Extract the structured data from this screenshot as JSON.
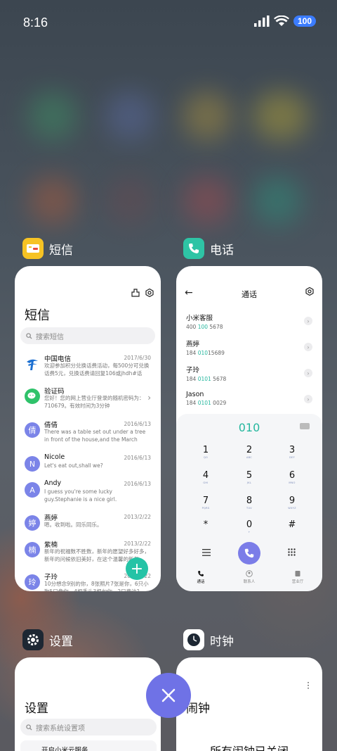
{
  "status_bar": {
    "time": "8:16",
    "battery": "100"
  },
  "apps": {
    "sms": {
      "label": "短信",
      "title": "短信",
      "search_placeholder": "搜索短信",
      "messages": [
        {
          "avatar": "",
          "name": "中国电信",
          "date": "2017/6/30",
          "preview": "欢迎参加积分兑换话费活动，每500分可兑换话费5元，兑换话费请回复106或jhdh#话费..."
        },
        {
          "avatar": "",
          "name": "验证码",
          "date": "",
          "preview": "您好！您的网上营业厅登录的随机密码为：710679。有效时间为3分钟"
        },
        {
          "avatar": "倩",
          "name": "倩倩",
          "date": "2016/6/13",
          "preview": "There was a table set out under a tree in front of the house,and the March Hare an..."
        },
        {
          "avatar": "N",
          "name": "Nicole",
          "date": "2016/6/13",
          "preview": "Let's eat out,shall we?"
        },
        {
          "avatar": "A",
          "name": "Andy",
          "date": "2016/6/13",
          "preview": "I guess you're some lucky guy.Stephanie is a nice girl."
        },
        {
          "avatar": "婷",
          "name": "燕婷",
          "date": "2013/2/22",
          "preview": "嗯。收到啦。同乐同乐。"
        },
        {
          "avatar": "楠",
          "name": "紫楠",
          "date": "2013/2/22",
          "preview": "新年的祝福数不胜数，新年的愿望好多好多，新年的问候依旧美好，在这个温馨的新年..."
        },
        {
          "avatar": "玲",
          "name": "子玲",
          "date": "2013/2/22",
          "preview": "10分想念9别的你，8张照片7张是你，6只小狗5只像你，4根香头3根句你，2只费油1官..."
        }
      ]
    },
    "phone": {
      "label": "电话",
      "title": "通话",
      "contacts": [
        {
          "name": "小米客服",
          "num_a": "400 ",
          "num_hl": "100",
          "num_b": " 5678"
        },
        {
          "name": "燕婷",
          "num_a": "184 ",
          "num_hl": "010",
          "num_b": "15689"
        },
        {
          "name": "子玲",
          "num_a": "184 ",
          "num_hl": "0101",
          "num_b": " 5678"
        },
        {
          "name": "Jason",
          "num_a": "184 ",
          "num_hl": "0101",
          "num_b": " 0029"
        }
      ],
      "dial_number": "010",
      "keys": [
        {
          "num": "1",
          "sub": "QO"
        },
        {
          "num": "2",
          "sub": "ABC"
        },
        {
          "num": "3",
          "sub": "DEF"
        },
        {
          "num": "4",
          "sub": "GHI"
        },
        {
          "num": "5",
          "sub": "JKL"
        },
        {
          "num": "6",
          "sub": "MNO"
        },
        {
          "num": "7",
          "sub": "PQRS"
        },
        {
          "num": "8",
          "sub": "TUV"
        },
        {
          "num": "9",
          "sub": "WXYZ"
        },
        {
          "num": "*",
          "sub": ""
        },
        {
          "num": "0",
          "sub": "+"
        },
        {
          "num": "#",
          "sub": ""
        }
      ],
      "tabs": [
        "通话",
        "联系人",
        "营业厅"
      ]
    },
    "settings": {
      "label": "设置",
      "title": "设置",
      "search_placeholder": "搜索系统设置项",
      "first_item": "开启小米云服务"
    },
    "clock": {
      "label": "时钟",
      "title": "闹钟",
      "status": "所有闹钟已关闭"
    }
  },
  "colors": {
    "accent_teal": "#25c3a6",
    "accent_purple": "#6f72e6",
    "avatar_purple": "#7b84e8"
  }
}
